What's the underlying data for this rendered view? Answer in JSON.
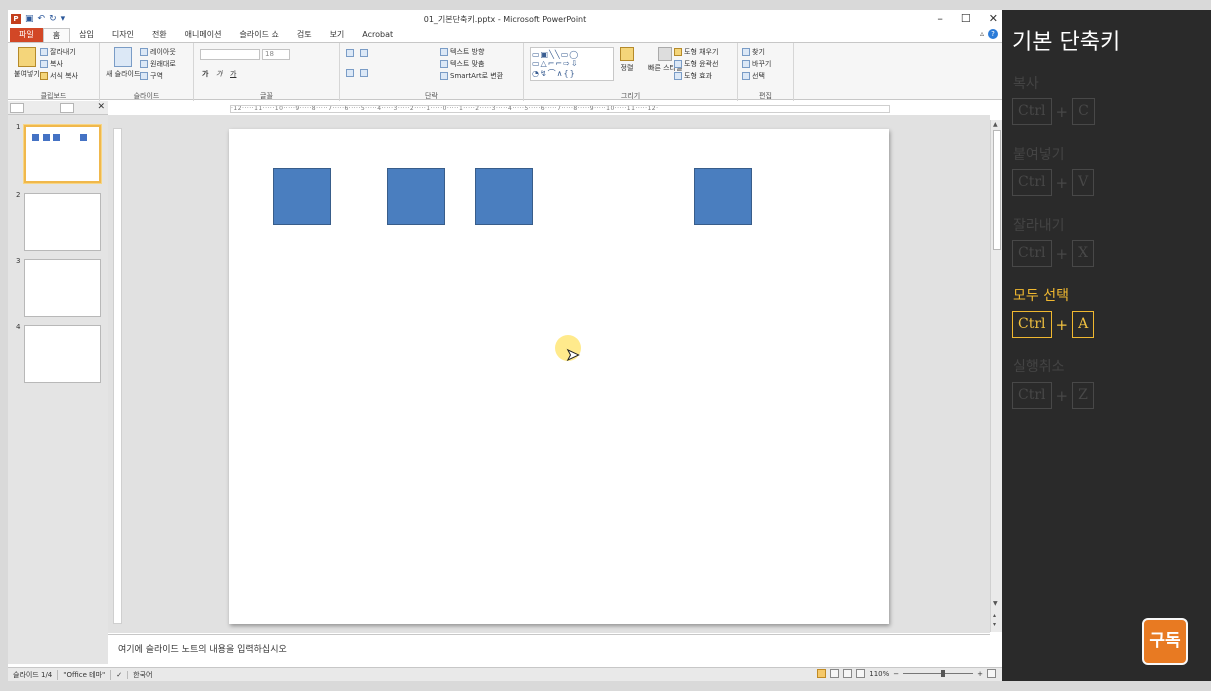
{
  "window": {
    "title": "01_기본단축키.pptx - Microsoft PowerPoint",
    "minimize": "–",
    "restore": "☐",
    "close": "✕"
  },
  "qat": {
    "logo": "P",
    "save": "▣",
    "undo": "↶",
    "redo": "↻",
    "more": "▾"
  },
  "tabs": [
    "파일",
    "홈",
    "삽입",
    "디자인",
    "전환",
    "애니메이션",
    "슬라이드 쇼",
    "검토",
    "보기",
    "Acrobat"
  ],
  "ribbon": {
    "clipboard": {
      "label": "클립보드",
      "paste": "붙여넣기",
      "cut": "잘라내기",
      "copy": "복사",
      "format_painter": "서식 복사"
    },
    "slides": {
      "label": "슬라이드",
      "new_slide": "새 슬라이드",
      "layout": "레이아웃",
      "reset": "원래대로",
      "section": "구역"
    },
    "font": {
      "label": "글꼴",
      "size": "18",
      "bold": "가",
      "italic": "가",
      "underline": "가"
    },
    "paragraph": {
      "label": "단락",
      "text_direction": "텍스트 방향",
      "align_text": "텍스트 맞춤",
      "smartart": "SmartArt로 변환"
    },
    "drawing": {
      "label": "그리기",
      "arrange": "정렬",
      "quick_styles": "빠른 스타일",
      "fill": "도형 채우기",
      "outline": "도형 윤곽선",
      "effects": "도형 효과"
    },
    "editing": {
      "label": "편집",
      "find": "찾기",
      "replace": "바꾸기",
      "select": "선택"
    }
  },
  "thumbnails": [
    {
      "num": "1",
      "selected": true
    },
    {
      "num": "2",
      "selected": false
    },
    {
      "num": "3",
      "selected": false
    },
    {
      "num": "4",
      "selected": false
    }
  ],
  "ruler": "·12·····11·····10·····9·····8·····7·····6·····5·····4·····3·····2·····1·····0·····1·····2·····3·····4·····5·····6·····7·····8·····9·····10·····11·····12·",
  "slide": {
    "shape_color": "#4a7ebf"
  },
  "notes": {
    "placeholder": "여기에 슬라이드 노트의 내용을 입력하십시오"
  },
  "status": {
    "slide_info": "슬라이드 1/4",
    "theme": "\"Office 테마\"",
    "language": "한국어",
    "zoom": "110%",
    "zoom_minus": "−",
    "zoom_plus": "+"
  },
  "panel": {
    "title": "기본 단축키",
    "accent": "#f0b830",
    "shortcuts": [
      {
        "label": "복사",
        "mod": "Ctrl",
        "key": "C",
        "active": false
      },
      {
        "label": "붙여넣기",
        "mod": "Ctrl",
        "key": "V",
        "active": false
      },
      {
        "label": "잘라내기",
        "mod": "Ctrl",
        "key": "X",
        "active": false
      },
      {
        "label": "모두 선택",
        "mod": "Ctrl",
        "key": "A",
        "active": true
      },
      {
        "label": "실행취소",
        "mod": "Ctrl",
        "key": "Z",
        "active": false
      }
    ],
    "plus": "+",
    "subscribe": "구독"
  }
}
